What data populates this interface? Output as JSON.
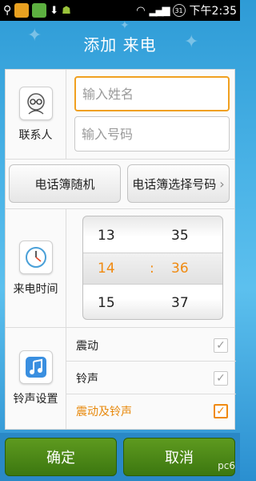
{
  "status_bar": {
    "signal": "31",
    "time": "下午2:35"
  },
  "header": {
    "title": "添加 来电"
  },
  "contact": {
    "label": "联系人",
    "name_placeholder": "输入姓名",
    "number_placeholder": "输入号码"
  },
  "actions": {
    "random_label": "电话簿随机",
    "choose_label": "电话簿选择号码"
  },
  "time_picker": {
    "label": "来电时间",
    "hours": [
      "13",
      "14",
      "15"
    ],
    "minutes": [
      "35",
      "36",
      "37"
    ],
    "separator": ":",
    "selected_hour": "14",
    "selected_minute": "36"
  },
  "ringtone": {
    "label": "铃声设置",
    "options": [
      {
        "label": "震动",
        "checked": false
      },
      {
        "label": "铃声",
        "checked": false
      },
      {
        "label": "震动及铃声",
        "checked": true
      }
    ]
  },
  "footer": {
    "confirm_label": "确定",
    "cancel_label": "取消",
    "watermark": "pc6"
  },
  "colors": {
    "accent": "#f08a10",
    "confirm_green": "#4a8a18",
    "header_blue": "#2e9bd6"
  }
}
